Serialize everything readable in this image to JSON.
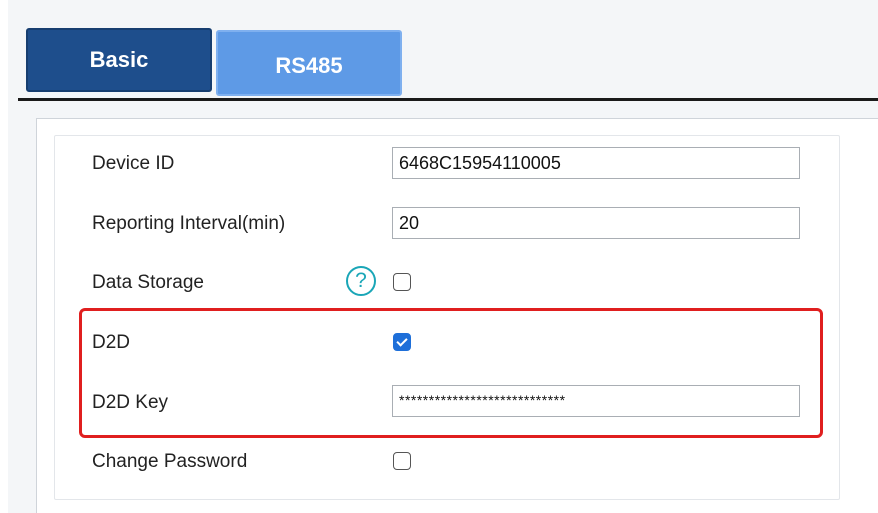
{
  "tabs": [
    {
      "label": "Basic",
      "active": true
    },
    {
      "label": "RS485",
      "active": false
    }
  ],
  "form": {
    "device_id": {
      "label": "Device ID",
      "value": "6468C15954110005"
    },
    "reporting_interval": {
      "label": "Reporting Interval(min)",
      "value": "20"
    },
    "data_storage": {
      "label": "Data Storage",
      "checked": false,
      "help_icon": "question-circle-icon"
    },
    "d2d": {
      "label": "D2D",
      "checked": true
    },
    "d2d_key": {
      "label": "D2D Key",
      "value": "****************************"
    },
    "change_password": {
      "label": "Change Password",
      "checked": false
    }
  },
  "colors": {
    "tab_active": "#1e4e8c",
    "tab_inactive": "#5e9ae6",
    "checkbox_checked": "#1e6fd9",
    "help_icon": "#1aa6b7",
    "highlight_box": "#e01f1f"
  }
}
